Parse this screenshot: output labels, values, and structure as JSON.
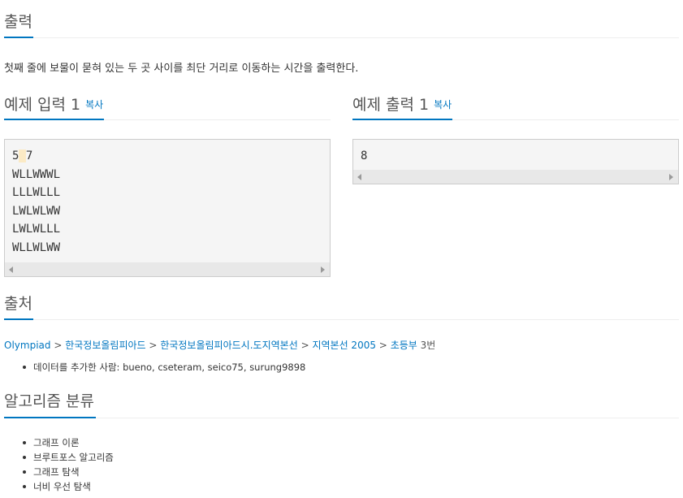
{
  "output_section": {
    "title": "출력",
    "description": "첫째 줄에 보물이 묻혀 있는 두 곳 사이를 최단 거리로 이동하는 시간을 출력한다."
  },
  "sample_input": {
    "title": "예제 입력 1",
    "copy_label": "복사",
    "lines": [
      "5 7",
      "WLLWWWL",
      "LLLWLLL",
      "LWLWLWW",
      "LWLWLLL",
      "WLLWLWW"
    ]
  },
  "sample_output": {
    "title": "예제 출력 1",
    "copy_label": "복사",
    "lines": [
      "8"
    ]
  },
  "source_section": {
    "title": "출처",
    "breadcrumb": [
      "Olympiad",
      "한국정보올림피아드",
      "한국정보올림피아드시.도지역본선",
      "지역본선 2005",
      "초등부"
    ],
    "breadcrumb_separator": ">",
    "problem_number": "3번",
    "data_added_label": "데이터를 추가한 사람:",
    "data_added_users": "bueno, cseteram, seico75, surung9898"
  },
  "algorithm_section": {
    "title": "알고리즘 분류",
    "tags": [
      "그래프 이론",
      "브루트포스 알고리즘",
      "그래프 탐색",
      "너비 우선 탐색"
    ]
  },
  "colors": {
    "accent": "#0076c0",
    "heading_text": "#555555",
    "pre_background": "#f5f5f5"
  }
}
